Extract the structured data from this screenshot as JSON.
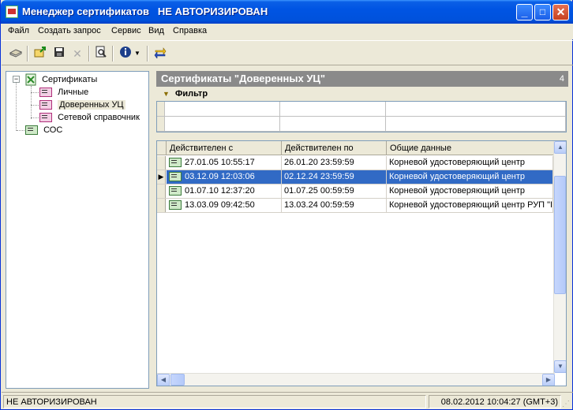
{
  "window": {
    "title": "Менеджер сертификатов",
    "auth_state": "НЕ АВТОРИЗИРОВАН"
  },
  "menu": [
    "Файл",
    "Создать запрос",
    "Сервис",
    "Вид",
    "Справка"
  ],
  "toolbar": {
    "icons": [
      "book-icon",
      "export-icon",
      "save-icon",
      "delete-icon",
      "view-icon",
      "info-icon",
      "dropdown-icon",
      "refresh-icon"
    ]
  },
  "tree": {
    "root": "Сертификаты",
    "children": [
      "Личные",
      "Доверенных УЦ",
      "Сетевой справочник"
    ],
    "sibling": "СОС"
  },
  "panel": {
    "title": "Сертификаты \"Доверенных УЦ\"",
    "count": "4",
    "filter_label": "Фильтр"
  },
  "table": {
    "columns": [
      "Действителен с",
      "Действителен по",
      "Общие данные"
    ],
    "rows": [
      {
        "from": "27.01.05 10:55:17",
        "to": "26.01.20 23:59:59",
        "subject": "Корневой удостоверяющий центр"
      },
      {
        "from": "03.12.09 12:03:06",
        "to": "02.12.24 23:59:59",
        "subject": "Корневой удостоверяющий центр"
      },
      {
        "from": "01.07.10 12:37:20",
        "to": "01.07.25 00:59:59",
        "subject": "Корневой удостоверяющий центр"
      },
      {
        "from": "13.03.09 09:42:50",
        "to": "13.03.24 00:59:59",
        "subject": "Корневой удостоверяющий центр РУП \"I"
      }
    ],
    "selected_index": 1
  },
  "status": {
    "auth": "НЕ АВТОРИЗИРОВАН",
    "datetime": "08.02.2012 10:04:27 (GMT+3)"
  },
  "colors": {
    "titlebar": "#0054e3",
    "selection": "#316ac5",
    "panel_header": "#8a8a8a"
  }
}
